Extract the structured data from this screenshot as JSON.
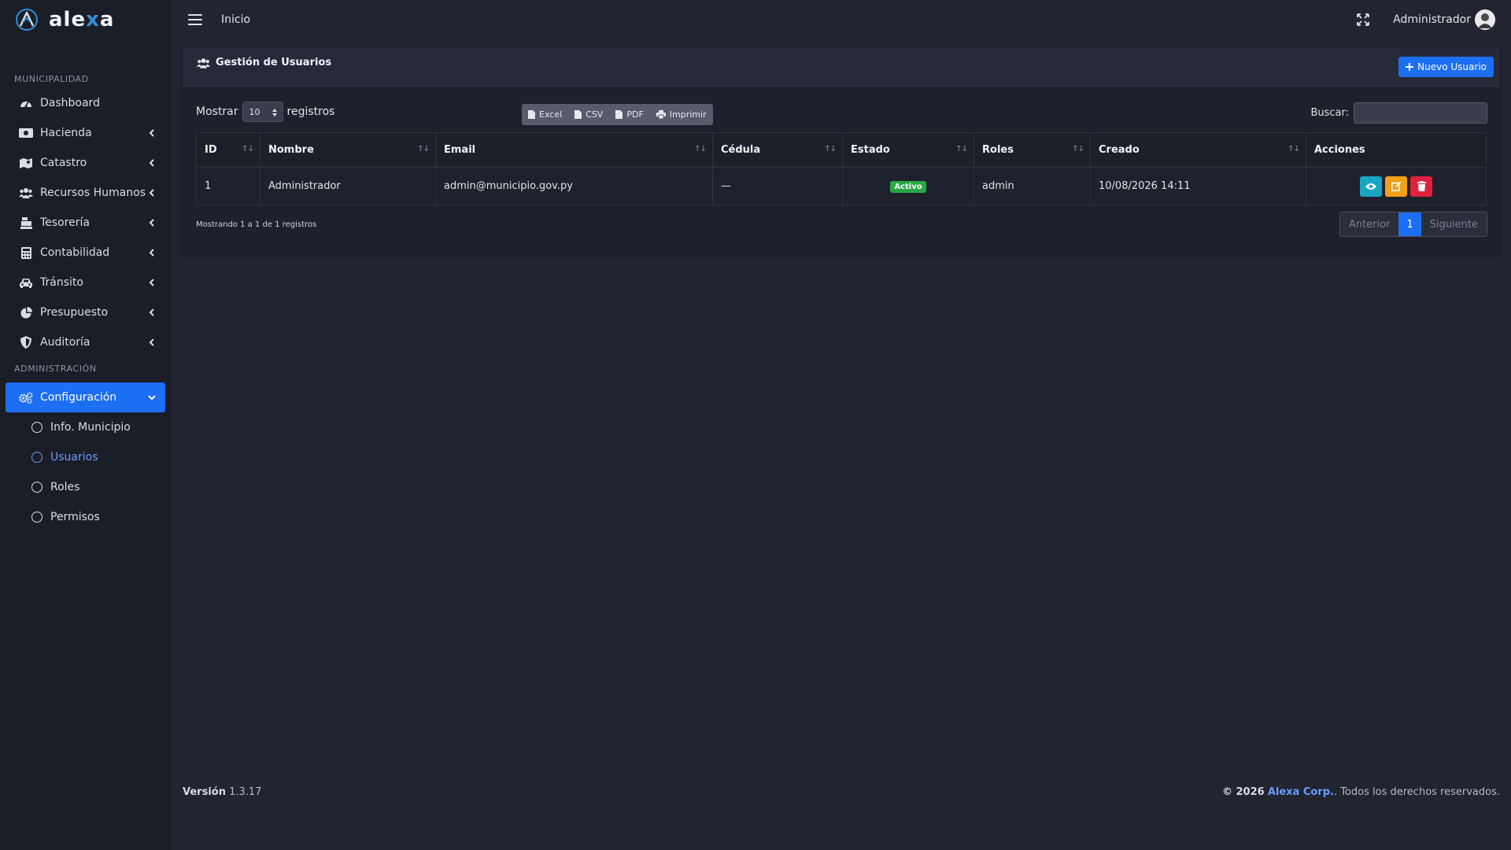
{
  "brand": {
    "name_pre": "ale",
    "name_x": "x",
    "name_post": "a"
  },
  "sidebar": {
    "header_1": "MUNICIPALIDAD",
    "header_2": "ADMINISTRACIÓN",
    "items": [
      {
        "label": "Dashboard",
        "icon": "gauge-icon"
      },
      {
        "label": "Hacienda",
        "icon": "money-bill-icon"
      },
      {
        "label": "Catastro",
        "icon": "map-icon"
      },
      {
        "label": "Recursos Humanos",
        "icon": "users-icon"
      },
      {
        "label": "Tesorería",
        "icon": "cash-register-icon"
      },
      {
        "label": "Contabilidad",
        "icon": "calculator-icon"
      },
      {
        "label": "Tránsito",
        "icon": "car-icon"
      },
      {
        "label": "Presupuesto",
        "icon": "pie-chart-icon"
      },
      {
        "label": "Auditoría",
        "icon": "shield-icon"
      }
    ],
    "config": {
      "label": "Configuración",
      "icon": "gears-icon"
    },
    "sub_items": [
      {
        "label": "Info. Municipio"
      },
      {
        "label": "Usuarios"
      },
      {
        "label": "Roles"
      },
      {
        "label": "Permisos"
      }
    ]
  },
  "topbar": {
    "home": "Inicio",
    "user": "Administrador"
  },
  "card": {
    "title": "Gestión de Usuarios",
    "new_button": "Nuevo Usuario",
    "show_label": "Mostrar",
    "records_label": "registros",
    "page_length": "10",
    "export": {
      "excel": "Excel",
      "csv": "CSV",
      "pdf": "PDF",
      "print": "Imprimir"
    },
    "search_label": "Buscar:",
    "search_value": ""
  },
  "table": {
    "headers": {
      "id": "ID",
      "nombre": "Nombre",
      "email": "Email",
      "cedula": "Cédula",
      "estado": "Estado",
      "roles": "Roles",
      "creado": "Creado",
      "acciones": "Acciones"
    },
    "rows": [
      {
        "id": "1",
        "nombre": "Administrador",
        "email": "admin@municipio.gov.py",
        "cedula": "—",
        "estado": "Activo",
        "roles": "admin",
        "creado": "10/08/2026 14:11"
      }
    ]
  },
  "pagination": {
    "info": "Mostrando 1 a 1 de 1 registros",
    "prev": "Anterior",
    "current": "1",
    "next": "Siguiente"
  },
  "footer": {
    "version_label": "Versión",
    "version": "1.3.17",
    "copyright": "© 2026",
    "corp": "Alexa Corp.",
    "rights": ". Todos los derechos reservados."
  },
  "colors": {
    "accent": "#1c6ef2",
    "success": "#27a844",
    "info": "#18a6c2",
    "warning": "#f0a11a",
    "danger": "#e0213f"
  }
}
